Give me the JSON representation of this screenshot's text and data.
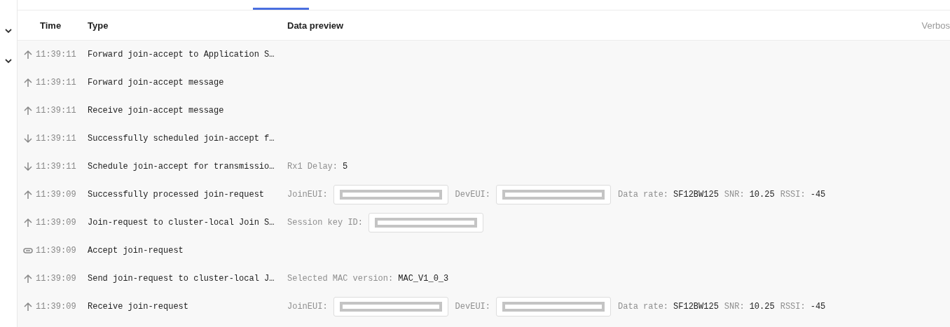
{
  "sidebar": {
    "items": [
      {
        "expanded": false
      },
      {
        "expanded": false
      }
    ]
  },
  "table": {
    "columns": [
      "Time",
      "Type",
      "Data preview",
      "Verbos"
    ],
    "rows": [
      {
        "kind": "up",
        "time": "11:39:11",
        "type": "Forward join-accept to Application S…",
        "preview": []
      },
      {
        "kind": "up",
        "time": "11:39:11",
        "type": "Forward join-accept message",
        "preview": []
      },
      {
        "kind": "up",
        "time": "11:39:11",
        "type": "Receive join-accept message",
        "preview": []
      },
      {
        "kind": "down",
        "time": "11:39:11",
        "type": "Successfully scheduled join-accept f…",
        "preview": []
      },
      {
        "kind": "down",
        "time": "11:39:11",
        "type": "Schedule join-accept for transmissio…",
        "preview": [
          {
            "kind": "pair",
            "label": "Rx1 Delay:",
            "value": "5"
          }
        ]
      },
      {
        "kind": "up",
        "time": "11:39:09",
        "type": "Successfully processed join-request",
        "preview": [
          {
            "kind": "masked",
            "label": "JoinEUI:"
          },
          {
            "kind": "masked",
            "label": "DevEUI:"
          },
          {
            "kind": "pair",
            "label": "Data rate:",
            "value": "SF12BW125"
          },
          {
            "kind": "pair",
            "label": "SNR:",
            "value": "10.25"
          },
          {
            "kind": "pair",
            "label": "RSSI:",
            "value": "-45"
          }
        ]
      },
      {
        "kind": "up",
        "time": "11:39:09",
        "type": "Join-request to cluster-local Join S…",
        "preview": [
          {
            "kind": "masked",
            "label": "Session key ID:"
          }
        ]
      },
      {
        "kind": "link",
        "time": "11:39:09",
        "type": "Accept join-request",
        "preview": []
      },
      {
        "kind": "up",
        "time": "11:39:09",
        "type": "Send join-request to cluster-local J…",
        "preview": [
          {
            "kind": "pair",
            "label": "Selected MAC version:",
            "value": "MAC_V1_0_3"
          }
        ]
      },
      {
        "kind": "up",
        "time": "11:39:09",
        "type": "Receive join-request",
        "preview": [
          {
            "kind": "masked",
            "label": "JoinEUI:"
          },
          {
            "kind": "masked",
            "label": "DevEUI:"
          },
          {
            "kind": "pair",
            "label": "Data rate:",
            "value": "SF12BW125"
          },
          {
            "kind": "pair",
            "label": "SNR:",
            "value": "10.25"
          },
          {
            "kind": "pair",
            "label": "RSSI:",
            "value": "-45"
          }
        ]
      }
    ]
  }
}
